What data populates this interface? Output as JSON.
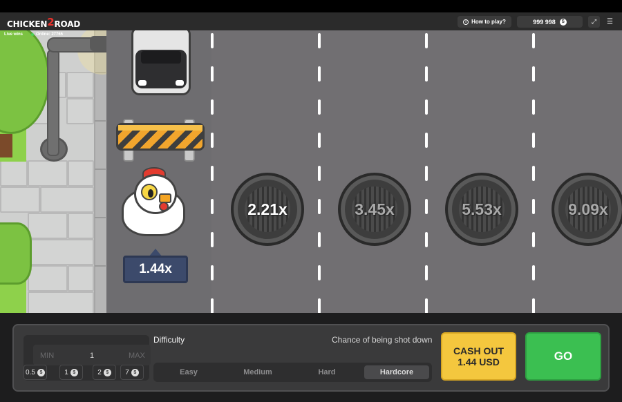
{
  "header": {
    "logo_text": "CHICKEN",
    "logo_two": "2",
    "logo_road": "ROAD",
    "how_to_play": "How to play?",
    "balance": "999 998",
    "currency_symbol": "$",
    "fullscreen_icon": "expand-icon",
    "menu_icon": "hamburger-icon"
  },
  "scene": {
    "live_wins_label": "Live wins",
    "online_label": "Online: 27765",
    "current_multiplier": "1.44x",
    "manholes": [
      {
        "label": "2.21x",
        "active": true
      },
      {
        "label": "3.45x",
        "active": false
      },
      {
        "label": "5.53x",
        "active": false
      },
      {
        "label": "9.09x",
        "active": false
      }
    ]
  },
  "controls": {
    "bet_min_label": "MIN",
    "bet_max_label": "MAX",
    "bet_value": "1",
    "chips": [
      "0.5",
      "1",
      "2",
      "7"
    ],
    "difficulty_label": "Difficulty",
    "chance_label": "Chance of being shot down",
    "difficulties": [
      "Easy",
      "Medium",
      "Hard",
      "Hardcore"
    ],
    "selected_difficulty": "Hardcore",
    "cashout_line1": "CASH OUT",
    "cashout_line2": "1.44 USD",
    "go_label": "GO"
  },
  "colors": {
    "cashout": "#f4c73e",
    "go": "#3bbf51",
    "road": "#716f72",
    "multiplier_tag": "#3c4a6b"
  }
}
